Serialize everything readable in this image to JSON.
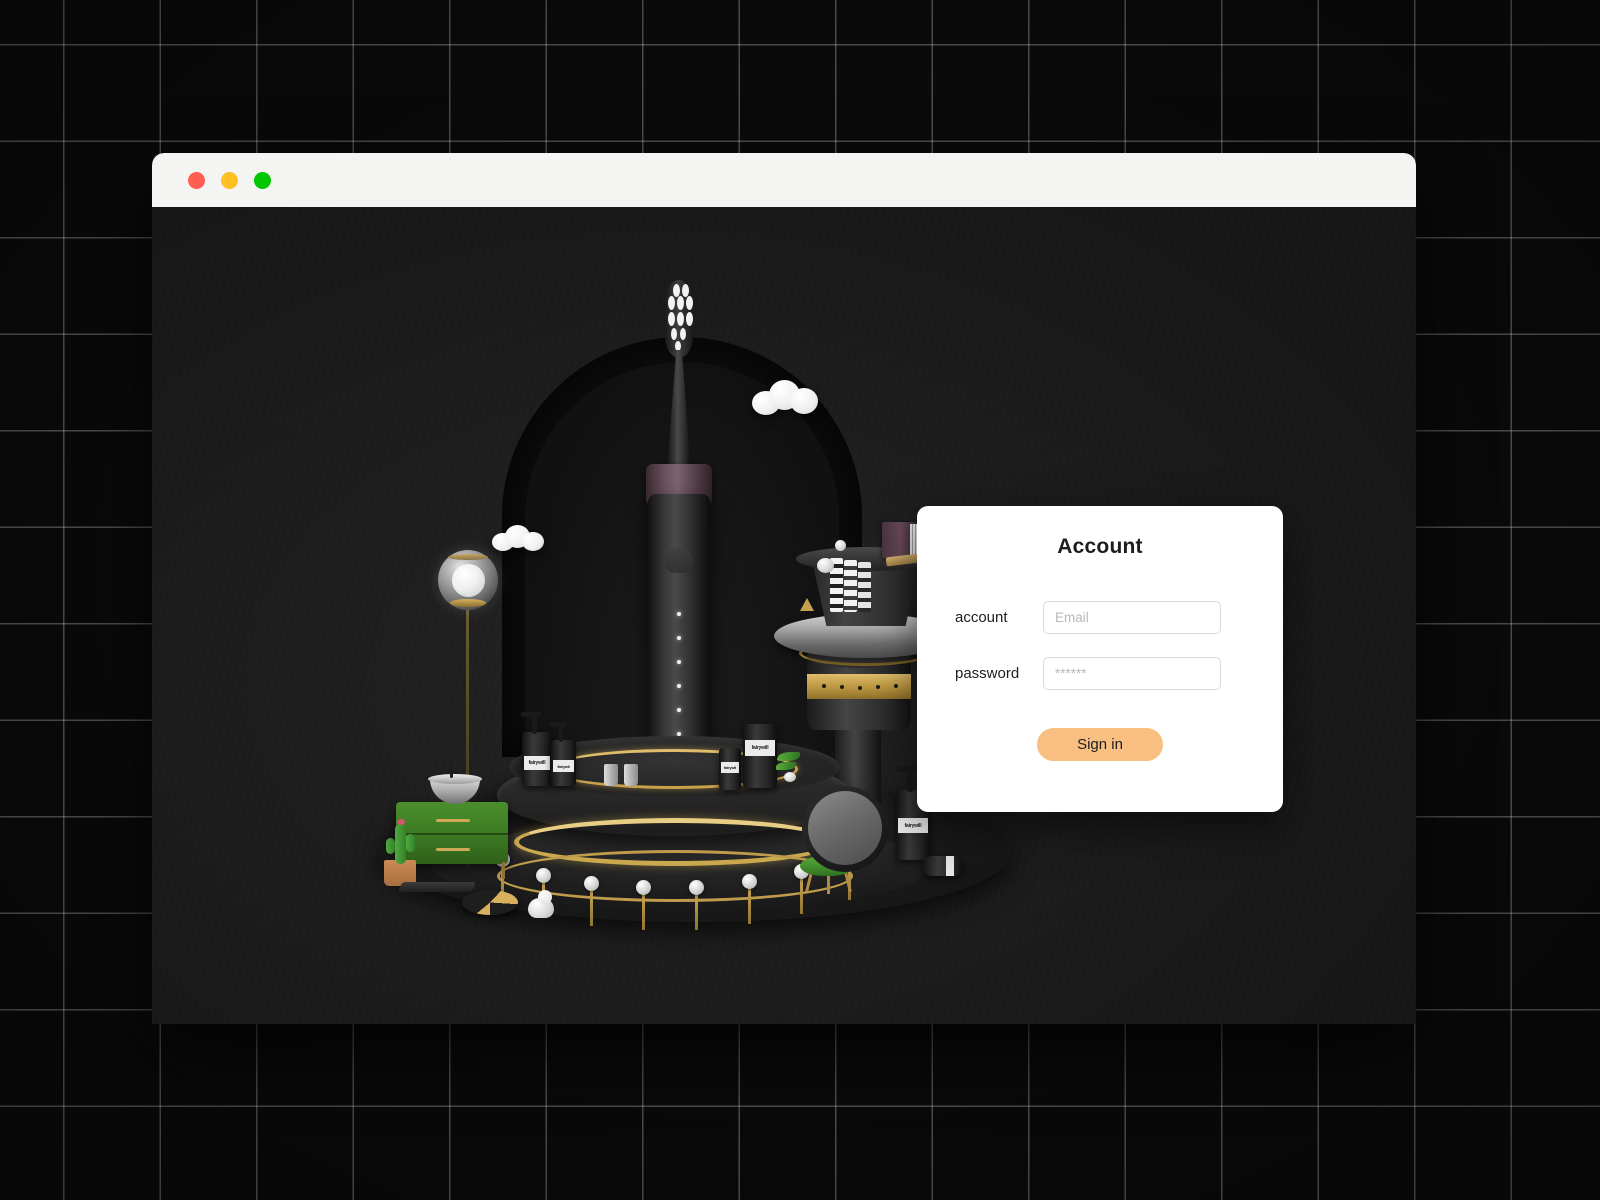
{
  "window": {
    "traffic_lights": [
      {
        "name": "close",
        "color": "#ff5f52"
      },
      {
        "name": "minimize",
        "color": "#ffc021"
      },
      {
        "name": "maximize",
        "color": "#00c700"
      }
    ]
  },
  "login_card": {
    "title": "Account",
    "fields": [
      {
        "label": "account",
        "placeholder": "Email",
        "value": "",
        "type": "text"
      },
      {
        "label": "password",
        "placeholder": "******",
        "value": "",
        "type": "text"
      }
    ],
    "submit_label": "Sign in"
  },
  "illustration": {
    "alt": "3D electric toothbrush product scene",
    "brand_text": "fairywill",
    "brand_text_short": "fairywil",
    "colors": {
      "scene_background": "#1b1b1b",
      "gold": "#c9a14a",
      "cactus_green": "#4fab3d",
      "cabinet_green": "#3d7a24",
      "collar_mauve": "#7d6370",
      "cloud_white": "#ffffff"
    }
  },
  "theme": {
    "page_background": "#0b0b0b",
    "grid_line": "rgba(255,255,255,0.30)",
    "titlebar": "#f4f4f3",
    "card_background": "#ffffff",
    "accent": "#f8bf80",
    "text_primary": "#1d1d1d",
    "placeholder": "#b9b9b9"
  }
}
